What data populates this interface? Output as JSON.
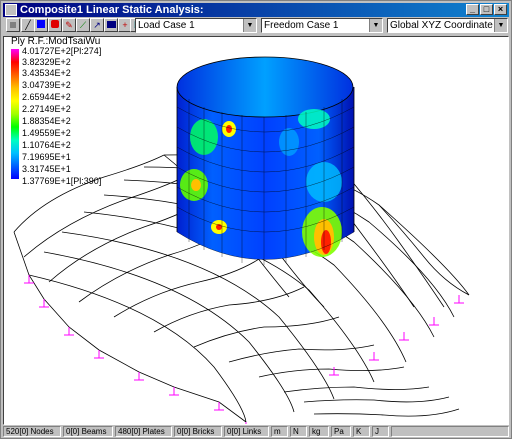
{
  "window": {
    "title": "Composite1 Linear Static Analysis:",
    "minimize": "_",
    "maximize": "□",
    "close": "×"
  },
  "toolbar": {
    "load_case": "Load Case 1",
    "freedom_case": "Freedom Case 1",
    "coord_system": "Global XYZ Coordinate Syste"
  },
  "legend": {
    "title": "Ply R.F.:ModTsaiWu",
    "values": [
      "4.01727E+2[Pl:274]",
      "3.82329E+2",
      "3.43534E+2",
      "3.04739E+2",
      "2.65944E+2",
      "2.27149E+2",
      "1.88354E+2",
      "1.49559E+2",
      "1.10764E+2",
      "7.19695E+1",
      "3.31745E+1",
      "1.37769E+1[Pl:390]"
    ]
  },
  "status": {
    "nodes": "520[0] Nodes",
    "beams": "0[0] Beams",
    "plates": "480[0] Plates",
    "bricks": "0[0] Bricks",
    "links": "0[0] Links",
    "units": [
      "m",
      "N",
      "kg",
      "Pa",
      "K",
      "J"
    ]
  }
}
